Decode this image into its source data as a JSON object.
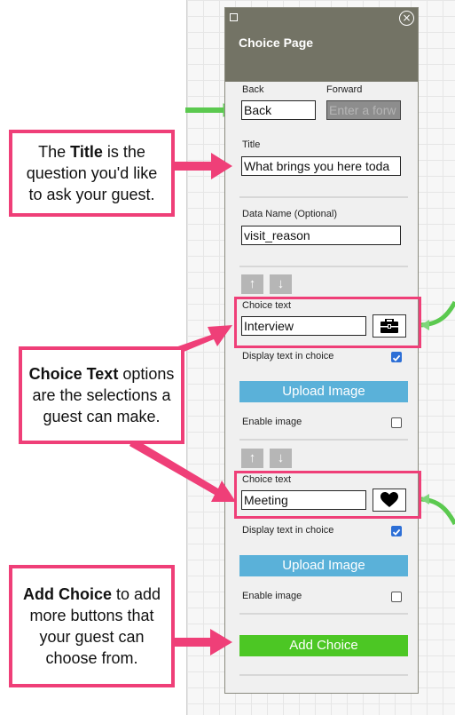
{
  "panel": {
    "title": "Choice Page",
    "close_glyph": "×",
    "back": {
      "label": "Back",
      "value": "Back"
    },
    "forward": {
      "label": "Forward",
      "placeholder": "Enter a forw"
    },
    "title_field": {
      "label": "Title",
      "value": "What brings you here toda"
    },
    "data_name": {
      "label": "Data Name (Optional)",
      "value": "visit_reason"
    },
    "choices": [
      {
        "label": "Choice text",
        "value": "Interview",
        "icon": "briefcase-icon",
        "display_text_label": "Display text in choice",
        "display_text_checked": true,
        "upload_label": "Upload Image",
        "enable_image_label": "Enable image",
        "enable_image_checked": false
      },
      {
        "label": "Choice text",
        "value": "Meeting",
        "icon": "heart-icon",
        "display_text_label": "Display text in choice",
        "display_text_checked": true,
        "upload_label": "Upload Image",
        "enable_image_label": "Enable image",
        "enable_image_checked": false
      }
    ],
    "add_choice_label": "Add Choice"
  },
  "callouts": {
    "title": {
      "pre": "The ",
      "bold": "Title",
      "post": " is the question you'd like to ask your guest."
    },
    "choice_text": {
      "pre": "",
      "bold": "Choice Text",
      "post": " options are the selections a guest can make."
    },
    "add_choice": {
      "pre": "",
      "bold": "Add Choice",
      "post": " to add more buttons that your guest can choose from."
    }
  },
  "colors": {
    "header": "#737365",
    "accent_pink": "#ef3f78",
    "upload_button": "#5ab1d9",
    "add_choice_button": "#4cc724",
    "checkbox_on": "#2d6fd6",
    "connector_green": "#5bc94f"
  }
}
